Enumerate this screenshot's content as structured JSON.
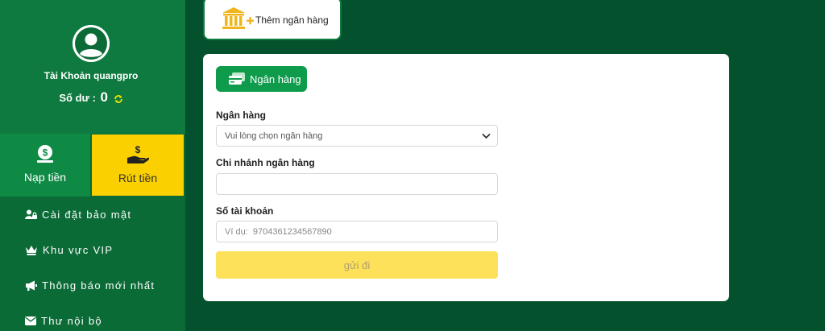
{
  "sidebar": {
    "account_name": "Tài Khoản quangpro",
    "balance_label": "Số dư :",
    "balance_value": "0",
    "deposit_label": "Nạp tiền",
    "withdraw_label": "Rút tiền",
    "menu": [
      {
        "label": "Cài đặt bảo mật",
        "icon": "user-lock-icon"
      },
      {
        "label": "Khu vực VIP",
        "icon": "crown-icon"
      },
      {
        "label": "Thông báo mới nhất",
        "icon": "megaphone-icon"
      },
      {
        "label": "Thư nội bộ",
        "icon": "envelope-icon"
      }
    ]
  },
  "top_tab": {
    "label": "Thêm ngân hàng",
    "icon": "bank-add-icon"
  },
  "form": {
    "section_label": "Ngân hàng",
    "bank_label": "Ngân hàng",
    "bank_select_value": "Vui lòng chọn ngân hàng",
    "branch_label": "Chi nhánh ngân hàng",
    "branch_value": "",
    "account_label": "Số tài khoản",
    "account_placeholder": "Ví dụ:  9704361234567890",
    "submit_label": "gửi đi"
  },
  "colors": {
    "background": "#03522d",
    "sidebar": "#0b6b37",
    "primary_green": "#0e9c4c",
    "withdraw_yellow": "#fbd000",
    "submit_yellow": "#fde15a"
  }
}
